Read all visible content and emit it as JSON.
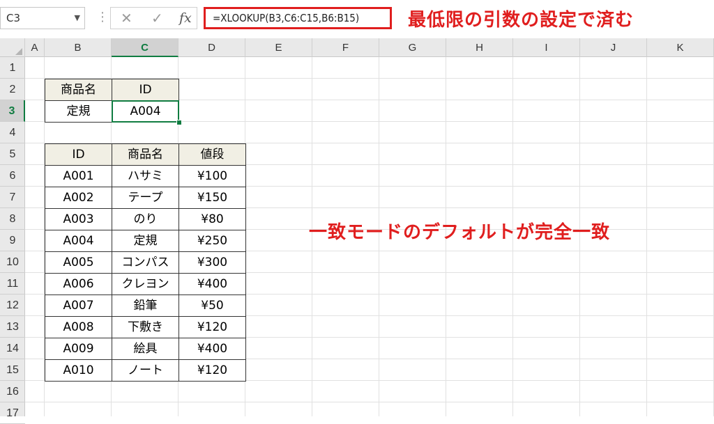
{
  "formula_bar": {
    "name_box": "C3",
    "cancel_icon": "✕",
    "confirm_icon": "✓",
    "fx_label": "fx",
    "formula": "=XLOOKUP(B3,C6:C15,B6:B15)"
  },
  "annotations": {
    "top": "最低限の引数の設定で済む",
    "middle": "一致モードのデフォルトが完全一致"
  },
  "columns": [
    "A",
    "B",
    "C",
    "D",
    "E",
    "F",
    "G",
    "H",
    "I",
    "J",
    "K"
  ],
  "rows": [
    "1",
    "2",
    "3",
    "4",
    "5",
    "6",
    "7",
    "8",
    "9",
    "10",
    "11",
    "12",
    "13",
    "14",
    "15",
    "16",
    "17"
  ],
  "selected_cell": {
    "col": "C",
    "row": "3"
  },
  "lookup_table": {
    "headers": [
      "商品名",
      "ID"
    ],
    "values": [
      "定規",
      "A004"
    ]
  },
  "product_table": {
    "headers": [
      "ID",
      "商品名",
      "値段"
    ],
    "rows": [
      [
        "A001",
        "ハサミ",
        "¥100"
      ],
      [
        "A002",
        "テープ",
        "¥150"
      ],
      [
        "A003",
        "のり",
        "¥80"
      ],
      [
        "A004",
        "定規",
        "¥250"
      ],
      [
        "A005",
        "コンパス",
        "¥300"
      ],
      [
        "A006",
        "クレヨン",
        "¥400"
      ],
      [
        "A007",
        "鉛筆",
        "¥50"
      ],
      [
        "A008",
        "下敷き",
        "¥120"
      ],
      [
        "A009",
        "絵具",
        "¥400"
      ],
      [
        "A010",
        "ノート",
        "¥120"
      ]
    ]
  },
  "colors": {
    "accent_red": "#e01e1e",
    "excel_green": "#107c41",
    "header_fill": "#f1efe4"
  }
}
